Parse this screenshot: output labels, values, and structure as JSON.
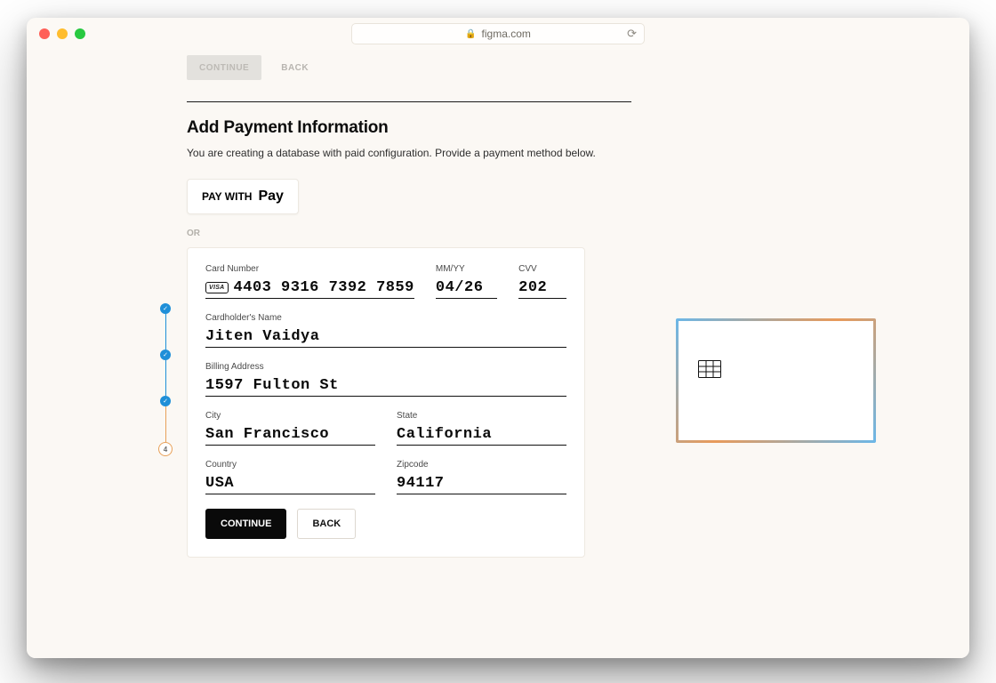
{
  "browser": {
    "url": "figma.com"
  },
  "ghost": {
    "continue": "CONTINUE",
    "back": "BACK"
  },
  "section": {
    "heading": "Add Payment Information",
    "subtext": "You are creating a database with paid configuration. Provide a payment method below."
  },
  "applePay": {
    "prefix": "PAY WITH",
    "brand": "Pay"
  },
  "or": "OR",
  "form": {
    "cardNumber": {
      "label": "Card Number",
      "value": "4403 9316 7392 7859",
      "brand": "VISA"
    },
    "expiry": {
      "label": "MM/YY",
      "value": "04/26"
    },
    "cvv": {
      "label": "CVV",
      "value": "202"
    },
    "name": {
      "label": "Cardholder's Name",
      "value": "Jiten Vaidya"
    },
    "address": {
      "label": "Billing Address",
      "value": "1597 Fulton St"
    },
    "city": {
      "label": "City",
      "value": "San Francisco"
    },
    "state": {
      "label": "State",
      "value": "California"
    },
    "country": {
      "label": "Country",
      "value": "USA"
    },
    "zipcode": {
      "label": "Zipcode",
      "value": "94117"
    },
    "actions": {
      "continue": "CONTINUE",
      "back": "BACK"
    }
  },
  "stepper": {
    "currentLabel": "4"
  }
}
